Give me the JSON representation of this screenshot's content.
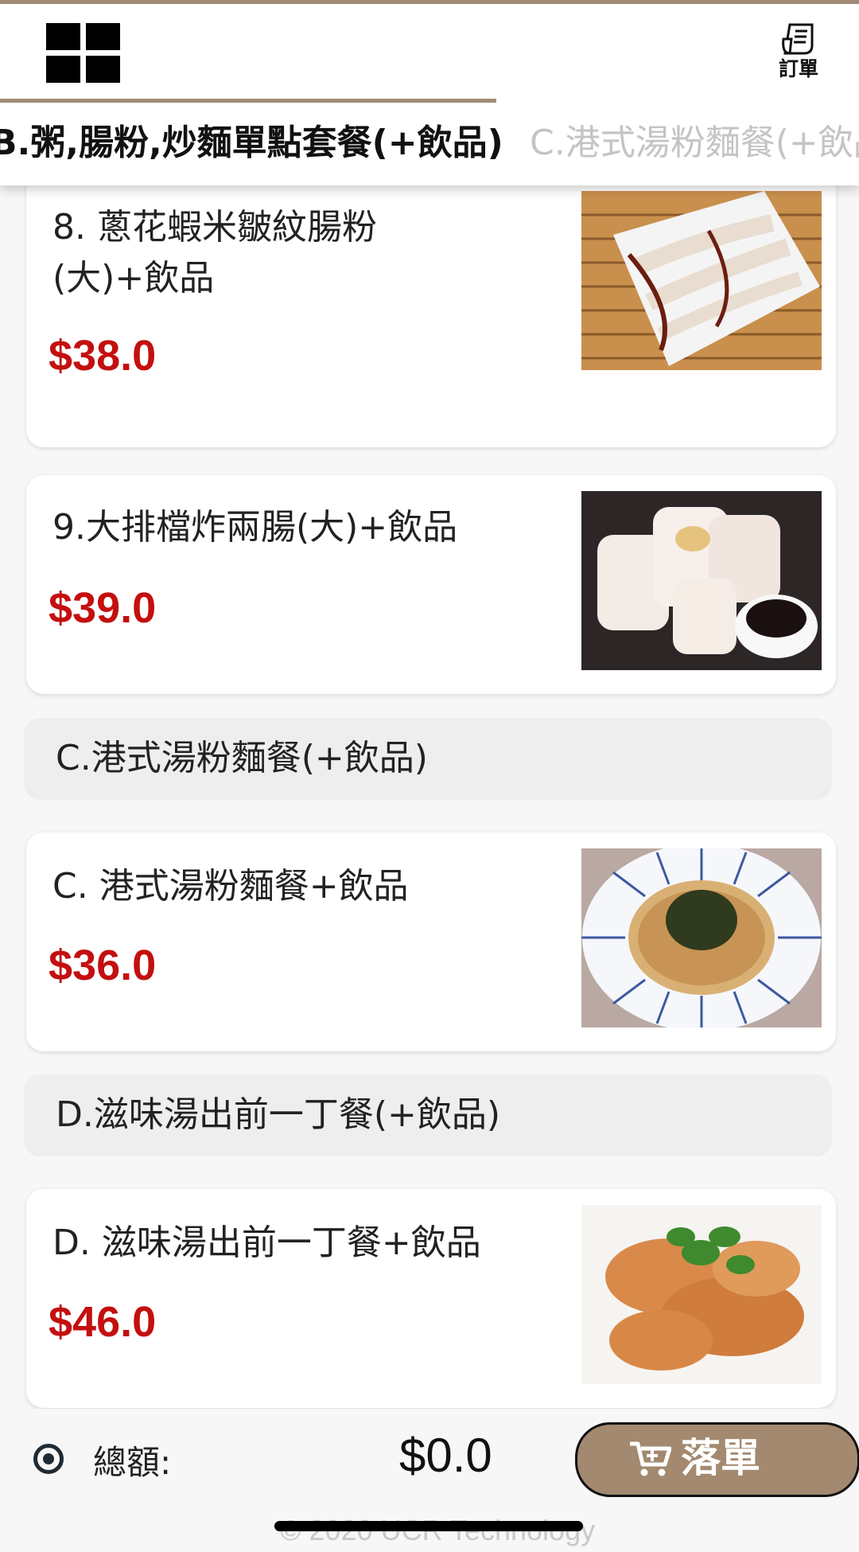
{
  "header": {
    "order_label": "訂單",
    "tabs": [
      {
        "label": "B.粥,腸粉,炒麵單點套餐(+飲品)",
        "active": true
      },
      {
        "label": "C.港式湯粉麵餐(+飲品)",
        "active": false
      }
    ]
  },
  "items": [
    {
      "name": "8. 蔥花蝦米皺紋腸粉(大)+飲品",
      "price": "$38.0",
      "image": "rice-noodle-roll-photo"
    },
    {
      "name": "9.大排檔炸兩腸(大)+飲品",
      "price": "$39.0",
      "image": "fried-dough-rice-roll-photo"
    },
    {
      "name": "C. 港式湯粉麵餐+飲品",
      "price": "$36.0",
      "image": "noodle-soup-photo"
    },
    {
      "name": "D. 滋味湯出前一丁餐+飲品",
      "price": "$46.0",
      "image": "fried-chicken-photo"
    }
  ],
  "sections": [
    {
      "title": "C.港式湯粉麵餐(+飲品)"
    },
    {
      "title": "D.滋味湯出前一丁餐(+飲品)"
    }
  ],
  "footer": {
    "total_label": "總額:",
    "total_value": "$0.0",
    "submit_label": "落單",
    "copyright": "© 2020 UCR Technology"
  },
  "colors": {
    "accent": "#a38c76",
    "price": "#c40f0f",
    "button": "#a3896f"
  }
}
